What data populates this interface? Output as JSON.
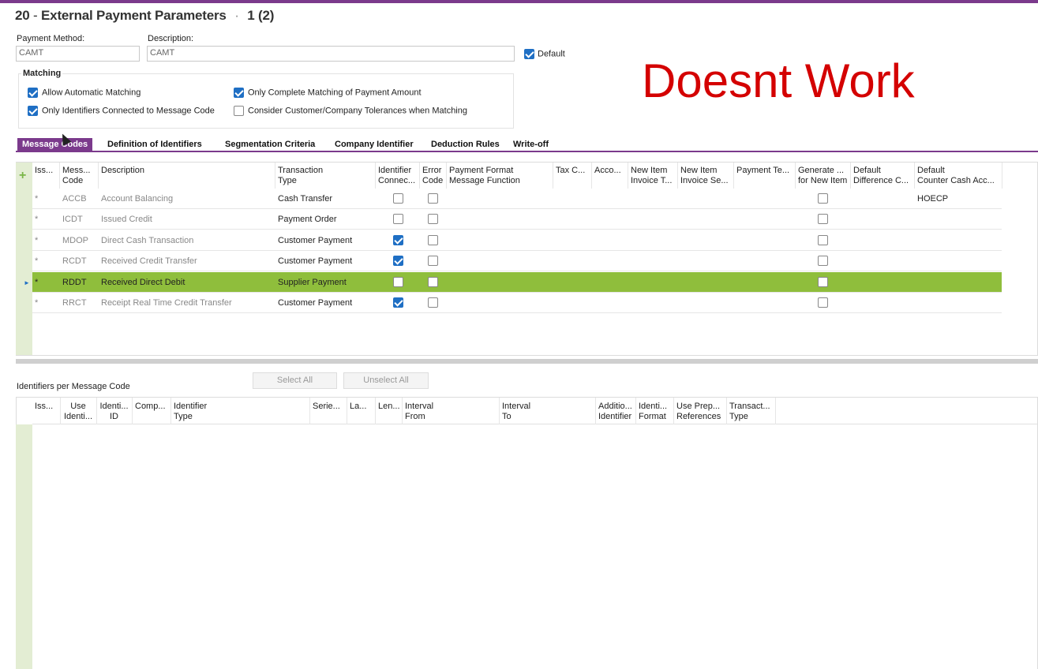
{
  "header": {
    "number": "20",
    "dash": "-",
    "title": "External Payment Parameters",
    "separator": "·",
    "record_index": "1 (2)"
  },
  "form": {
    "payment_method_label": "Payment Method:",
    "payment_method_value": "CAMT",
    "description_label": "Description:",
    "description_value": "CAMT",
    "default_label": "Default",
    "default_checked": true
  },
  "matching": {
    "title": "Matching",
    "options": [
      {
        "label": "Allow Automatic Matching",
        "checked": true
      },
      {
        "label": "Only Identifiers Connected to Message Code",
        "checked": true
      },
      {
        "label": "Only Complete Matching of Payment Amount",
        "checked": true
      },
      {
        "label": "Consider Customer/Company Tolerances when Matching",
        "checked": false
      }
    ]
  },
  "annotation": "Doesnt Work",
  "tabs": [
    {
      "label": "Message Codes",
      "active": true
    },
    {
      "label": "Definition of Identifiers",
      "active": false
    },
    {
      "label": "Segmentation Criteria",
      "active": false
    },
    {
      "label": "Company Identifier",
      "active": false
    },
    {
      "label": "Deduction Rules",
      "active": false
    },
    {
      "label": "Write-off",
      "active": false
    }
  ],
  "message_grid": {
    "add_symbol": "+",
    "columns": [
      {
        "l1": "Iss...",
        "l2": ""
      },
      {
        "l1": "Mess...",
        "l2": "Code"
      },
      {
        "l1": "Description",
        "l2": ""
      },
      {
        "l1": "Transaction",
        "l2": "Type"
      },
      {
        "l1": "Identifier",
        "l2": "Connec..."
      },
      {
        "l1": "Error",
        "l2": "Code"
      },
      {
        "l1": "Payment Format",
        "l2": "Message Function"
      },
      {
        "l1": "Tax C...",
        "l2": ""
      },
      {
        "l1": "Acco...",
        "l2": ""
      },
      {
        "l1": "New Item",
        "l2": "Invoice T..."
      },
      {
        "l1": "New Item",
        "l2": "Invoice Se..."
      },
      {
        "l1": "Payment Te...",
        "l2": ""
      },
      {
        "l1": "Generate ...",
        "l2": "for New Item"
      },
      {
        "l1": "Default",
        "l2": "Difference C..."
      },
      {
        "l1": "Default",
        "l2": "Counter Cash Acc..."
      }
    ],
    "rows": [
      {
        "iss": "*",
        "code": "ACCB",
        "description": "Account Balancing",
        "type": "Cash Transfer",
        "identifier": false,
        "error": false,
        "generate": false,
        "counter_cash": "HOECP",
        "selected": false
      },
      {
        "iss": "*",
        "code": "ICDT",
        "description": "Issued Credit",
        "type": "Payment Order",
        "identifier": false,
        "error": false,
        "generate": false,
        "counter_cash": "",
        "selected": false
      },
      {
        "iss": "*",
        "code": "MDOP",
        "description": "Direct Cash Transaction",
        "type": "Customer Payment",
        "identifier": true,
        "error": false,
        "generate": false,
        "counter_cash": "",
        "selected": false
      },
      {
        "iss": "*",
        "code": "RCDT",
        "description": "Received Credit Transfer",
        "type": "Customer Payment",
        "identifier": true,
        "error": false,
        "generate": false,
        "counter_cash": "",
        "selected": false
      },
      {
        "iss": "*",
        "code": "RDDT",
        "description": "Received Direct Debit",
        "type": "Supplier Payment",
        "identifier": false,
        "error": false,
        "generate": false,
        "counter_cash": "",
        "selected": true
      },
      {
        "iss": "*",
        "code": "RRCT",
        "description": "Receipt Real Time Credit Transfer",
        "type": "Customer Payment",
        "identifier": true,
        "error": false,
        "generate": false,
        "counter_cash": "",
        "selected": false
      }
    ],
    "row_marker": "►"
  },
  "identifiers_section": {
    "title": "Identifiers per Message Code",
    "select_all": "Select All",
    "unselect_all": "Unselect All",
    "columns": [
      {
        "l1": "Iss...",
        "l2": ""
      },
      {
        "l1": "Use",
        "l2": "Identi..."
      },
      {
        "l1": "Identi...",
        "l2": "ID"
      },
      {
        "l1": "Comp...",
        "l2": ""
      },
      {
        "l1": "Identifier",
        "l2": "Type"
      },
      {
        "l1": "Serie...",
        "l2": ""
      },
      {
        "l1": "La...",
        "l2": ""
      },
      {
        "l1": "Len...",
        "l2": ""
      },
      {
        "l1": "Interval",
        "l2": "From"
      },
      {
        "l1": "Interval",
        "l2": "To"
      },
      {
        "l1": "Additio...",
        "l2": "Identifier"
      },
      {
        "l1": "Identi...",
        "l2": "Format"
      },
      {
        "l1": "Use Prep...",
        "l2": "References"
      },
      {
        "l1": "Transact...",
        "l2": "Type"
      }
    ]
  }
}
